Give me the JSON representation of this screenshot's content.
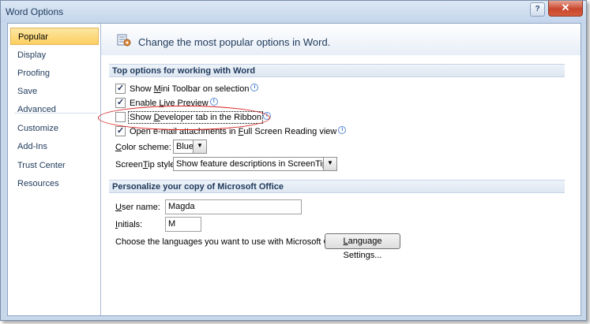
{
  "window": {
    "title": "Word Options",
    "close_label": "✕",
    "help_label": "?"
  },
  "sidebar": {
    "items": [
      {
        "label": "Popular"
      },
      {
        "label": "Display"
      },
      {
        "label": "Proofing"
      },
      {
        "label": "Save"
      },
      {
        "label": "Advanced"
      },
      {
        "label": "Customize"
      },
      {
        "label": "Add-Ins"
      },
      {
        "label": "Trust Center"
      },
      {
        "label": "Resources"
      }
    ],
    "selected": "Popular"
  },
  "header": {
    "text": "Change the most popular options in Word."
  },
  "top_options": {
    "heading": "Top options for working with Word",
    "checkboxes": [
      {
        "pre": "Show ",
        "key": "M",
        "post": "ini Toolbar on selection",
        "checked": true
      },
      {
        "pre": "Enable ",
        "key": "L",
        "post": "ive Preview",
        "checked": true
      },
      {
        "pre": "Show ",
        "key": "D",
        "post": "eveloper tab in the Ribbon",
        "checked": false
      },
      {
        "pre": "Open e-mail attachments in ",
        "key": "F",
        "post": "ull Screen Reading view",
        "checked": true
      }
    ],
    "color_scheme": {
      "key": "C",
      "label_rest": "olor scheme:",
      "value": "Blue"
    },
    "screentip": {
      "label_pre": "Screen",
      "key": "T",
      "label_rest": "ip style:",
      "value": "Show feature descriptions in ScreenTips"
    }
  },
  "personalize": {
    "heading": "Personalize your copy of Microsoft Office",
    "user_name": {
      "key": "U",
      "label_rest": "ser name:",
      "value": "Magda"
    },
    "initials": {
      "key": "I",
      "label_rest": "nitials:",
      "value": "M"
    },
    "languages_label": "Choose the languages you want to use with Microsoft Office:",
    "language_button": {
      "key": "L",
      "label_rest": "anguage Settings..."
    }
  }
}
